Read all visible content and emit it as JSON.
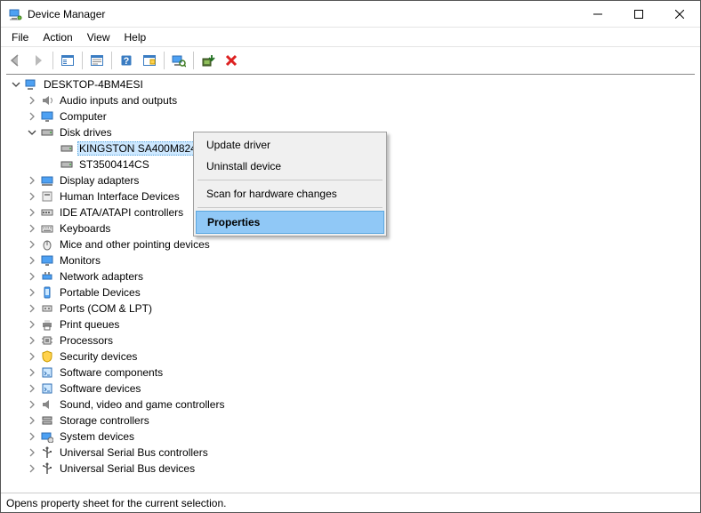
{
  "titlebar": {
    "title": "Device Manager"
  },
  "menubar": {
    "items": [
      "File",
      "Action",
      "View",
      "Help"
    ]
  },
  "toolbar": {
    "buttons": [
      {
        "name": "back",
        "enabled": false
      },
      {
        "name": "forward",
        "enabled": false
      },
      {
        "name": "show-hide-console-tree",
        "enabled": true
      },
      {
        "name": "properties-sheet",
        "enabled": true
      },
      {
        "name": "help",
        "enabled": true
      },
      {
        "name": "action-center",
        "enabled": true
      },
      {
        "name": "scan-hardware",
        "enabled": true
      },
      {
        "name": "update-driver",
        "enabled": true
      },
      {
        "name": "uninstall-device",
        "enabled": true
      }
    ]
  },
  "tree": {
    "root": {
      "label": "DESKTOP-4BM4ESI",
      "icon": "computer-icon",
      "expanded": true,
      "children": [
        {
          "label": "Audio inputs and outputs",
          "icon": "speaker-icon",
          "expanded": false,
          "has_children": true
        },
        {
          "label": "Computer",
          "icon": "monitor-icon",
          "expanded": false,
          "has_children": true
        },
        {
          "label": "Disk drives",
          "icon": "disk-icon",
          "expanded": true,
          "has_children": true,
          "children": [
            {
              "label": "KINGSTON SA400M8240G",
              "icon": "disk-icon",
              "selected": true
            },
            {
              "label": "ST3500414CS",
              "icon": "disk-icon"
            }
          ]
        },
        {
          "label": "Display adapters",
          "icon": "display-adapter-icon",
          "expanded": false,
          "has_children": true
        },
        {
          "label": "Human Interface Devices",
          "icon": "hid-icon",
          "expanded": false,
          "has_children": true
        },
        {
          "label": "IDE ATA/ATAPI controllers",
          "icon": "ide-icon",
          "expanded": false,
          "has_children": true
        },
        {
          "label": "Keyboards",
          "icon": "keyboard-icon",
          "expanded": false,
          "has_children": true
        },
        {
          "label": "Mice and other pointing devices",
          "icon": "mouse-icon",
          "expanded": false,
          "has_children": true
        },
        {
          "label": "Monitors",
          "icon": "monitor-icon",
          "expanded": false,
          "has_children": true
        },
        {
          "label": "Network adapters",
          "icon": "network-icon",
          "expanded": false,
          "has_children": true
        },
        {
          "label": "Portable Devices",
          "icon": "portable-icon",
          "expanded": false,
          "has_children": true
        },
        {
          "label": "Ports (COM & LPT)",
          "icon": "port-icon",
          "expanded": false,
          "has_children": true
        },
        {
          "label": "Print queues",
          "icon": "printer-icon",
          "expanded": false,
          "has_children": true
        },
        {
          "label": "Processors",
          "icon": "cpu-icon",
          "expanded": false,
          "has_children": true
        },
        {
          "label": "Security devices",
          "icon": "security-icon",
          "expanded": false,
          "has_children": true
        },
        {
          "label": "Software components",
          "icon": "software-icon",
          "expanded": false,
          "has_children": true
        },
        {
          "label": "Software devices",
          "icon": "software-icon",
          "expanded": false,
          "has_children": true
        },
        {
          "label": "Sound, video and game controllers",
          "icon": "sound-icon",
          "expanded": false,
          "has_children": true
        },
        {
          "label": "Storage controllers",
          "icon": "storage-icon",
          "expanded": false,
          "has_children": true
        },
        {
          "label": "System devices",
          "icon": "system-icon",
          "expanded": false,
          "has_children": true
        },
        {
          "label": "Universal Serial Bus controllers",
          "icon": "usb-icon",
          "expanded": false,
          "has_children": true
        },
        {
          "label": "Universal Serial Bus devices",
          "icon": "usb-icon",
          "expanded": false,
          "has_children": true
        }
      ]
    }
  },
  "context_menu": {
    "items": [
      {
        "label": "Update driver",
        "highlighted": false
      },
      {
        "label": "Uninstall device",
        "highlighted": false
      },
      {
        "sep": true
      },
      {
        "label": "Scan for hardware changes",
        "highlighted": false
      },
      {
        "sep": true
      },
      {
        "label": "Properties",
        "highlighted": true
      }
    ]
  },
  "statusbar": {
    "text": "Opens property sheet for the current selection."
  }
}
